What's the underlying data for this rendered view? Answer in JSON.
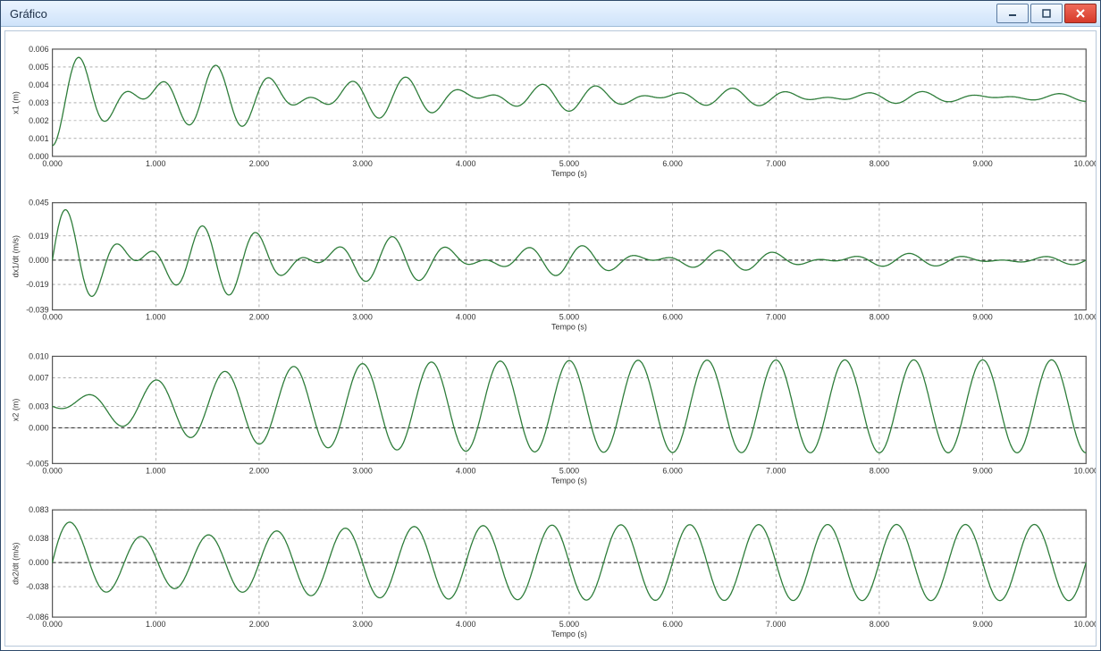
{
  "window": {
    "title": "Gráfico"
  },
  "chart_data": [
    {
      "type": "line",
      "title": "",
      "xlabel": "Tempo (s)",
      "ylabel": "x1 (m)",
      "xlim": [
        0,
        10
      ],
      "ylim": [
        0,
        0.006
      ],
      "xticks": [
        0.0,
        1.0,
        2.0,
        3.0,
        4.0,
        5.0,
        6.0,
        7.0,
        8.0,
        9.0,
        10.0
      ],
      "yticks": [
        0.0,
        0.001,
        0.002,
        0.003,
        0.004,
        0.005,
        0.006
      ],
      "signal": {
        "kind": "damped-beat",
        "baseline": 0.0033,
        "amp": 0.0027,
        "decay": 0.25,
        "phase_deg": -90,
        "f1": 2.2,
        "f2": 1.6
      }
    },
    {
      "type": "line",
      "title": "",
      "xlabel": "Tempo (s)",
      "ylabel": "dx1/dt (m/s)",
      "xlim": [
        0,
        10
      ],
      "ylim": [
        -0.039,
        0.045
      ],
      "xticks": [
        0.0,
        1.0,
        2.0,
        3.0,
        4.0,
        5.0,
        6.0,
        7.0,
        8.0,
        9.0,
        10.0
      ],
      "yticks": [
        -0.039,
        -0.019,
        0.0,
        0.019,
        0.045
      ],
      "signal": {
        "kind": "damped-beat",
        "baseline": 0.0,
        "amp": 0.042,
        "decay": 0.25,
        "phase_deg": 0,
        "f1": 2.2,
        "f2": 1.6
      }
    },
    {
      "type": "line",
      "title": "",
      "xlabel": "Tempo (s)",
      "ylabel": "x2 (m)",
      "xlim": [
        0,
        10
      ],
      "ylim": [
        -0.005,
        0.01
      ],
      "xticks": [
        0.0,
        1.0,
        2.0,
        3.0,
        4.0,
        5.0,
        6.0,
        7.0,
        8.0,
        9.0,
        10.0
      ],
      "yticks": [
        -0.005,
        0.0,
        0.003,
        0.007,
        0.01
      ],
      "signal": {
        "kind": "settling",
        "baseline": 0.003,
        "amp": 0.0065,
        "f": 1.5,
        "approach_tau": 1.2,
        "phase_deg": -90
      }
    },
    {
      "type": "line",
      "title": "",
      "xlabel": "Tempo (s)",
      "ylabel": "dx2/dt (m/s)",
      "xlim": [
        0,
        10
      ],
      "ylim": [
        -0.086,
        0.083
      ],
      "xticks": [
        0.0,
        1.0,
        2.0,
        3.0,
        4.0,
        5.0,
        6.0,
        7.0,
        8.0,
        9.0,
        10.0
      ],
      "yticks": [
        -0.086,
        -0.038,
        0.0,
        0.038,
        0.083
      ],
      "signal": {
        "kind": "settling",
        "baseline": 0.0,
        "amp": 0.06,
        "f": 1.5,
        "approach_tau": 1.2,
        "phase_deg": 0,
        "transient_amp": 0.08,
        "transient_tau": 0.8
      }
    }
  ],
  "style": {
    "line_color": "#2e7d3a",
    "grid_color": "#7f7f7f",
    "axis_color": "#555555"
  }
}
